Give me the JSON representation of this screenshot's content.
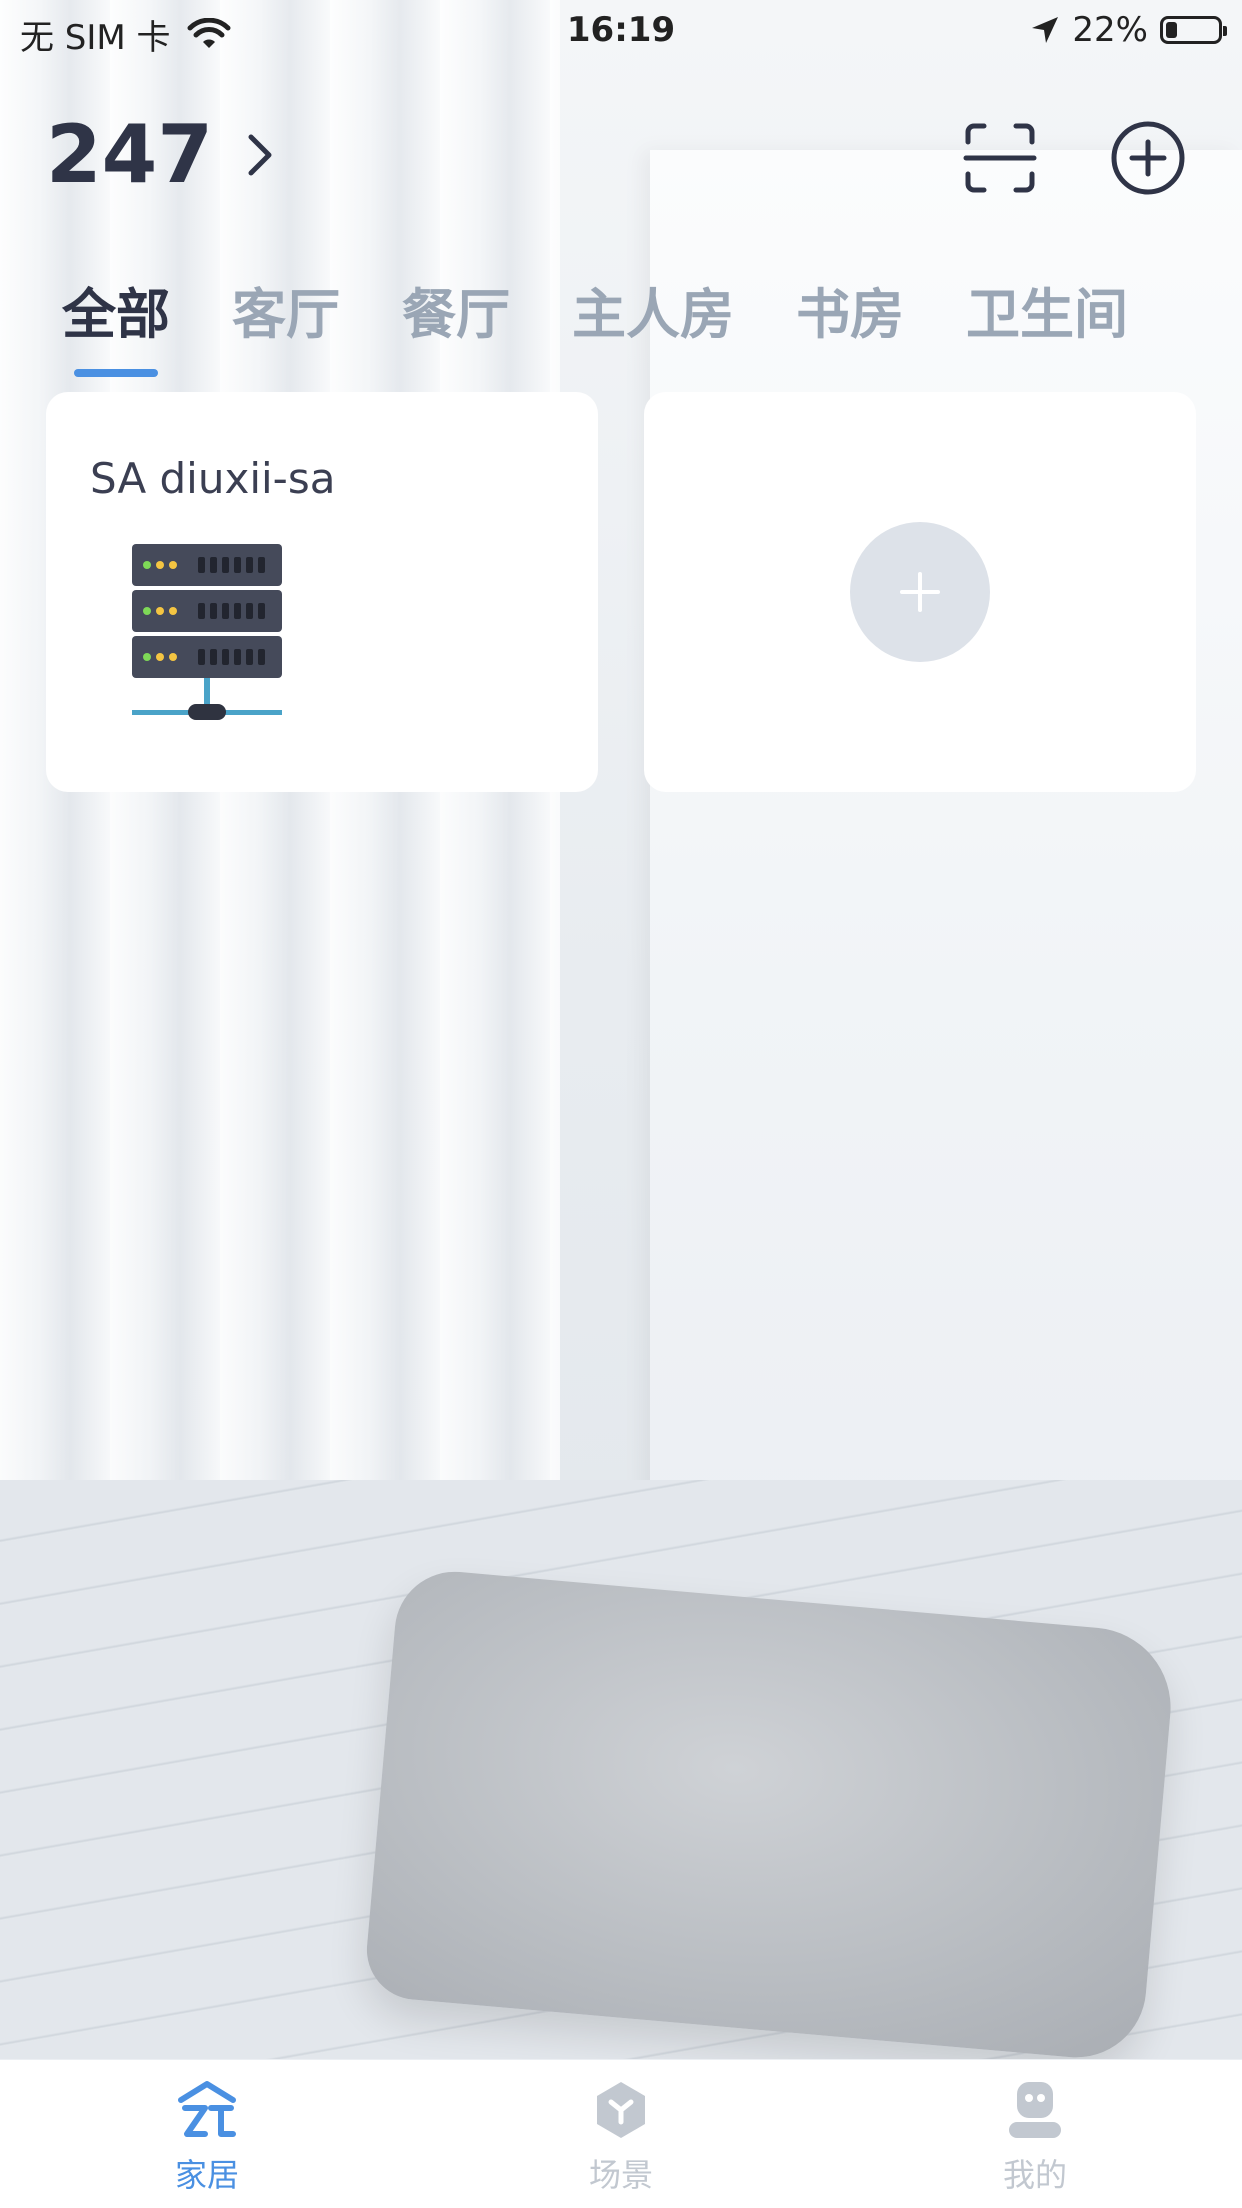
{
  "status_bar": {
    "carrier": "无 SIM 卡",
    "time": "16:19",
    "battery": "22%",
    "battery_level": 0.22
  },
  "header": {
    "home_name": "247",
    "chevron_icon": "chevron-right-icon",
    "scan_icon": "scan-icon",
    "add_icon": "add-circle-icon"
  },
  "tabs": [
    {
      "label": "全部",
      "active": true
    },
    {
      "label": "客厅",
      "active": false
    },
    {
      "label": "餐厅",
      "active": false
    },
    {
      "label": "主人房",
      "active": false
    },
    {
      "label": "书房",
      "active": false
    },
    {
      "label": "卫生间",
      "active": false
    }
  ],
  "devices": [
    {
      "name": "SA diuxii-sa",
      "icon": "server-rack-icon"
    }
  ],
  "add_device_icon": "plus-icon",
  "bottom_nav": [
    {
      "label": "家居",
      "icon": "home-icon",
      "active": true
    },
    {
      "label": "场景",
      "icon": "scene-icon",
      "active": false
    },
    {
      "label": "我的",
      "icon": "profile-icon",
      "active": false
    }
  ],
  "colors": {
    "accent": "#4a90e2",
    "text_dark": "#2f3447",
    "tab_inactive": "#9aa6b5",
    "nav_inactive": "#c2c8d0"
  }
}
